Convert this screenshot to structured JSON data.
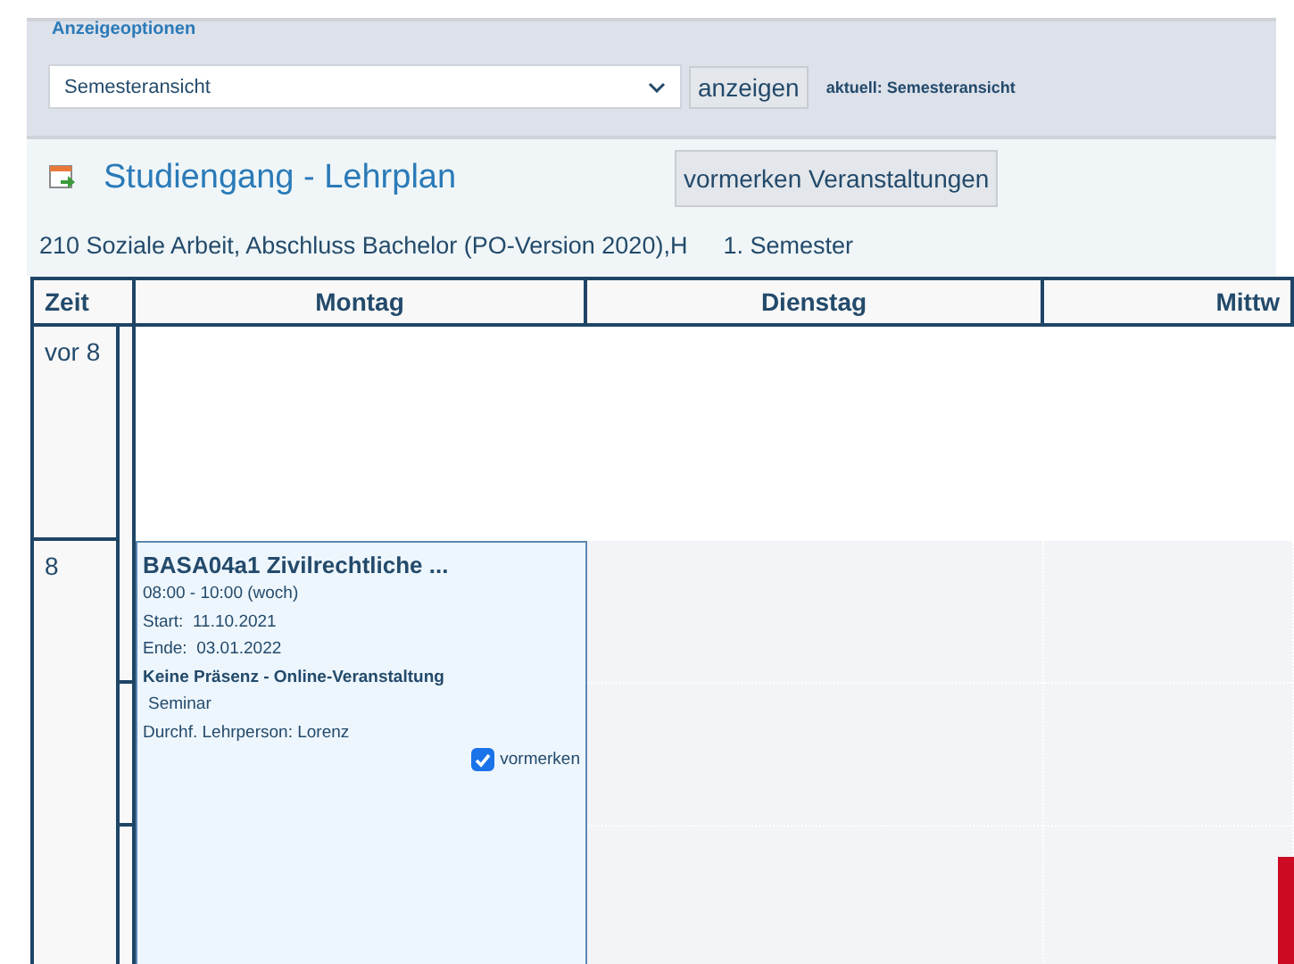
{
  "display_options": {
    "legend": "Anzeigeoptionen",
    "view_select": {
      "value": "Semesteransicht"
    },
    "show_button": "anzeigen",
    "current": "aktuell: Semesteransicht"
  },
  "heading": {
    "title": "Studiengang - Lehrplan",
    "bookmark_button": "vormerken Veranstaltungen"
  },
  "program": {
    "name": "210 Soziale Arbeit, Abschluss Bachelor (PO-Version 2020),H",
    "semester": "1. Semester"
  },
  "timetable": {
    "columns": [
      "Zeit",
      "Montag",
      "Dienstag",
      "Mittw"
    ],
    "rows": [
      {
        "time": "vor 8"
      },
      {
        "time": "8",
        "event": {
          "title": "BASA04a1 Zivilrechtliche ...",
          "time": "08:00 - 10:00 (woch)",
          "start": "Start:  11.10.2021",
          "end": "Ende:  03.01.2022",
          "status": "Keine Präsenz - Online-Veranstaltung",
          "type": "Seminar",
          "lecturer": "Durchf. Lehrperson: Lorenz",
          "bookmark": {
            "label": "vormerken",
            "checked": true
          }
        }
      }
    ]
  }
}
